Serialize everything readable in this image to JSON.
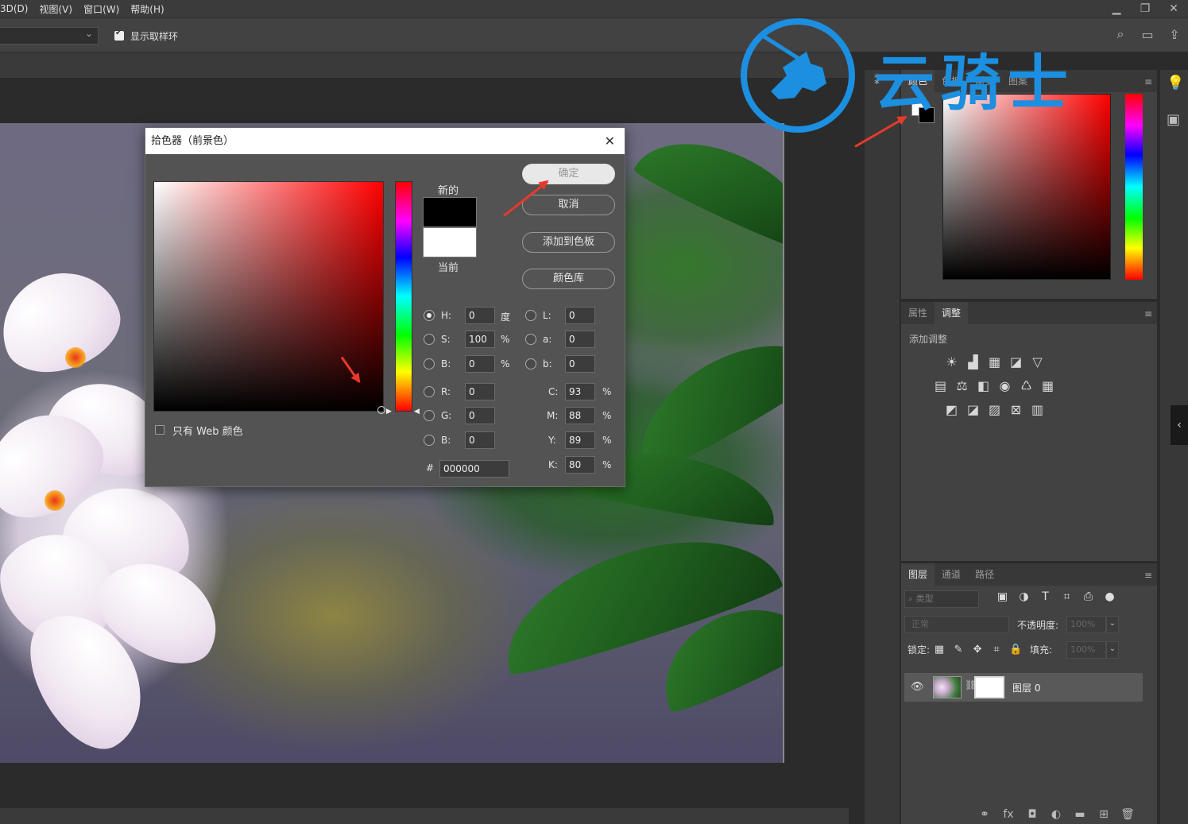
{
  "menu": {
    "items": [
      "3D(D)",
      "视图(V)",
      "窗口(W)",
      "帮助(H)"
    ],
    "window_controls": [
      "minimize-icon",
      "restore-icon",
      "close-icon"
    ]
  },
  "options_bar": {
    "sample_dropdown": "",
    "show_sampling_ring_label": "显示取样环",
    "show_sampling_ring_checked": true
  },
  "watermark": {
    "text": "云骑士",
    "color": "#1c8fe0"
  },
  "dialog": {
    "title": "拾色器（前景色）",
    "new_label": "新的",
    "current_label": "当前",
    "new_color": "#000000",
    "current_color": "#ffffff",
    "buttons": {
      "ok": "确定",
      "cancel": "取消",
      "add_to_swatches": "添加到色板",
      "color_libraries": "颜色库"
    },
    "web_only_label": "只有 Web 颜色",
    "fields": {
      "H": {
        "label": "H:",
        "value": "0",
        "unit": "度"
      },
      "S": {
        "label": "S:",
        "value": "100",
        "unit": "%"
      },
      "Bv": {
        "label": "B:",
        "value": "0",
        "unit": "%"
      },
      "R": {
        "label": "R:",
        "value": "0"
      },
      "G": {
        "label": "G:",
        "value": "0"
      },
      "Bc": {
        "label": "B:",
        "value": "0"
      },
      "L": {
        "label": "L:",
        "value": "0"
      },
      "a": {
        "label": "a:",
        "value": "0"
      },
      "b": {
        "label": "b:",
        "value": "0"
      },
      "C": {
        "label": "C:",
        "value": "93",
        "unit": "%"
      },
      "M": {
        "label": "M:",
        "value": "88",
        "unit": "%"
      },
      "Y": {
        "label": "Y:",
        "value": "89",
        "unit": "%"
      },
      "K": {
        "label": "K:",
        "value": "80",
        "unit": "%"
      }
    },
    "hex_label": "#",
    "hex_value": "000000"
  },
  "color_panel": {
    "tabs": [
      "颜色",
      "色板",
      "渐变",
      "图案"
    ]
  },
  "adjustments_panel": {
    "tabs": [
      "属性",
      "调整"
    ],
    "active_tab": "调整",
    "add_label": "添加调整",
    "row1": [
      "☀",
      "▟",
      "▦",
      "◪",
      "▽"
    ],
    "row2": [
      "▤",
      "⚖",
      "◧",
      "◉",
      "♺",
      "▦"
    ],
    "row3": [
      "◩",
      "◪",
      "▨",
      "⊠",
      "▥"
    ]
  },
  "layers_panel": {
    "tabs": [
      "图层",
      "通道",
      "路径"
    ],
    "active_tab": "图层",
    "filter_placeholder": "类型",
    "filter_icons": [
      "▣",
      "◑",
      "T",
      "⌗",
      "⎙",
      "●"
    ],
    "blend_mode": "正常",
    "opacity_label": "不透明度:",
    "opacity_value": "100%",
    "lock_label": "锁定:",
    "lock_icons": [
      "▦",
      "✎",
      "✥",
      "⌗",
      "🔒"
    ],
    "fill_label": "填充:",
    "fill_value": "100%",
    "layer_name": "图层 0",
    "footer_icons": [
      "⚭",
      "fx",
      "◘",
      "◐",
      "▬",
      "⊞",
      "🗑"
    ]
  }
}
